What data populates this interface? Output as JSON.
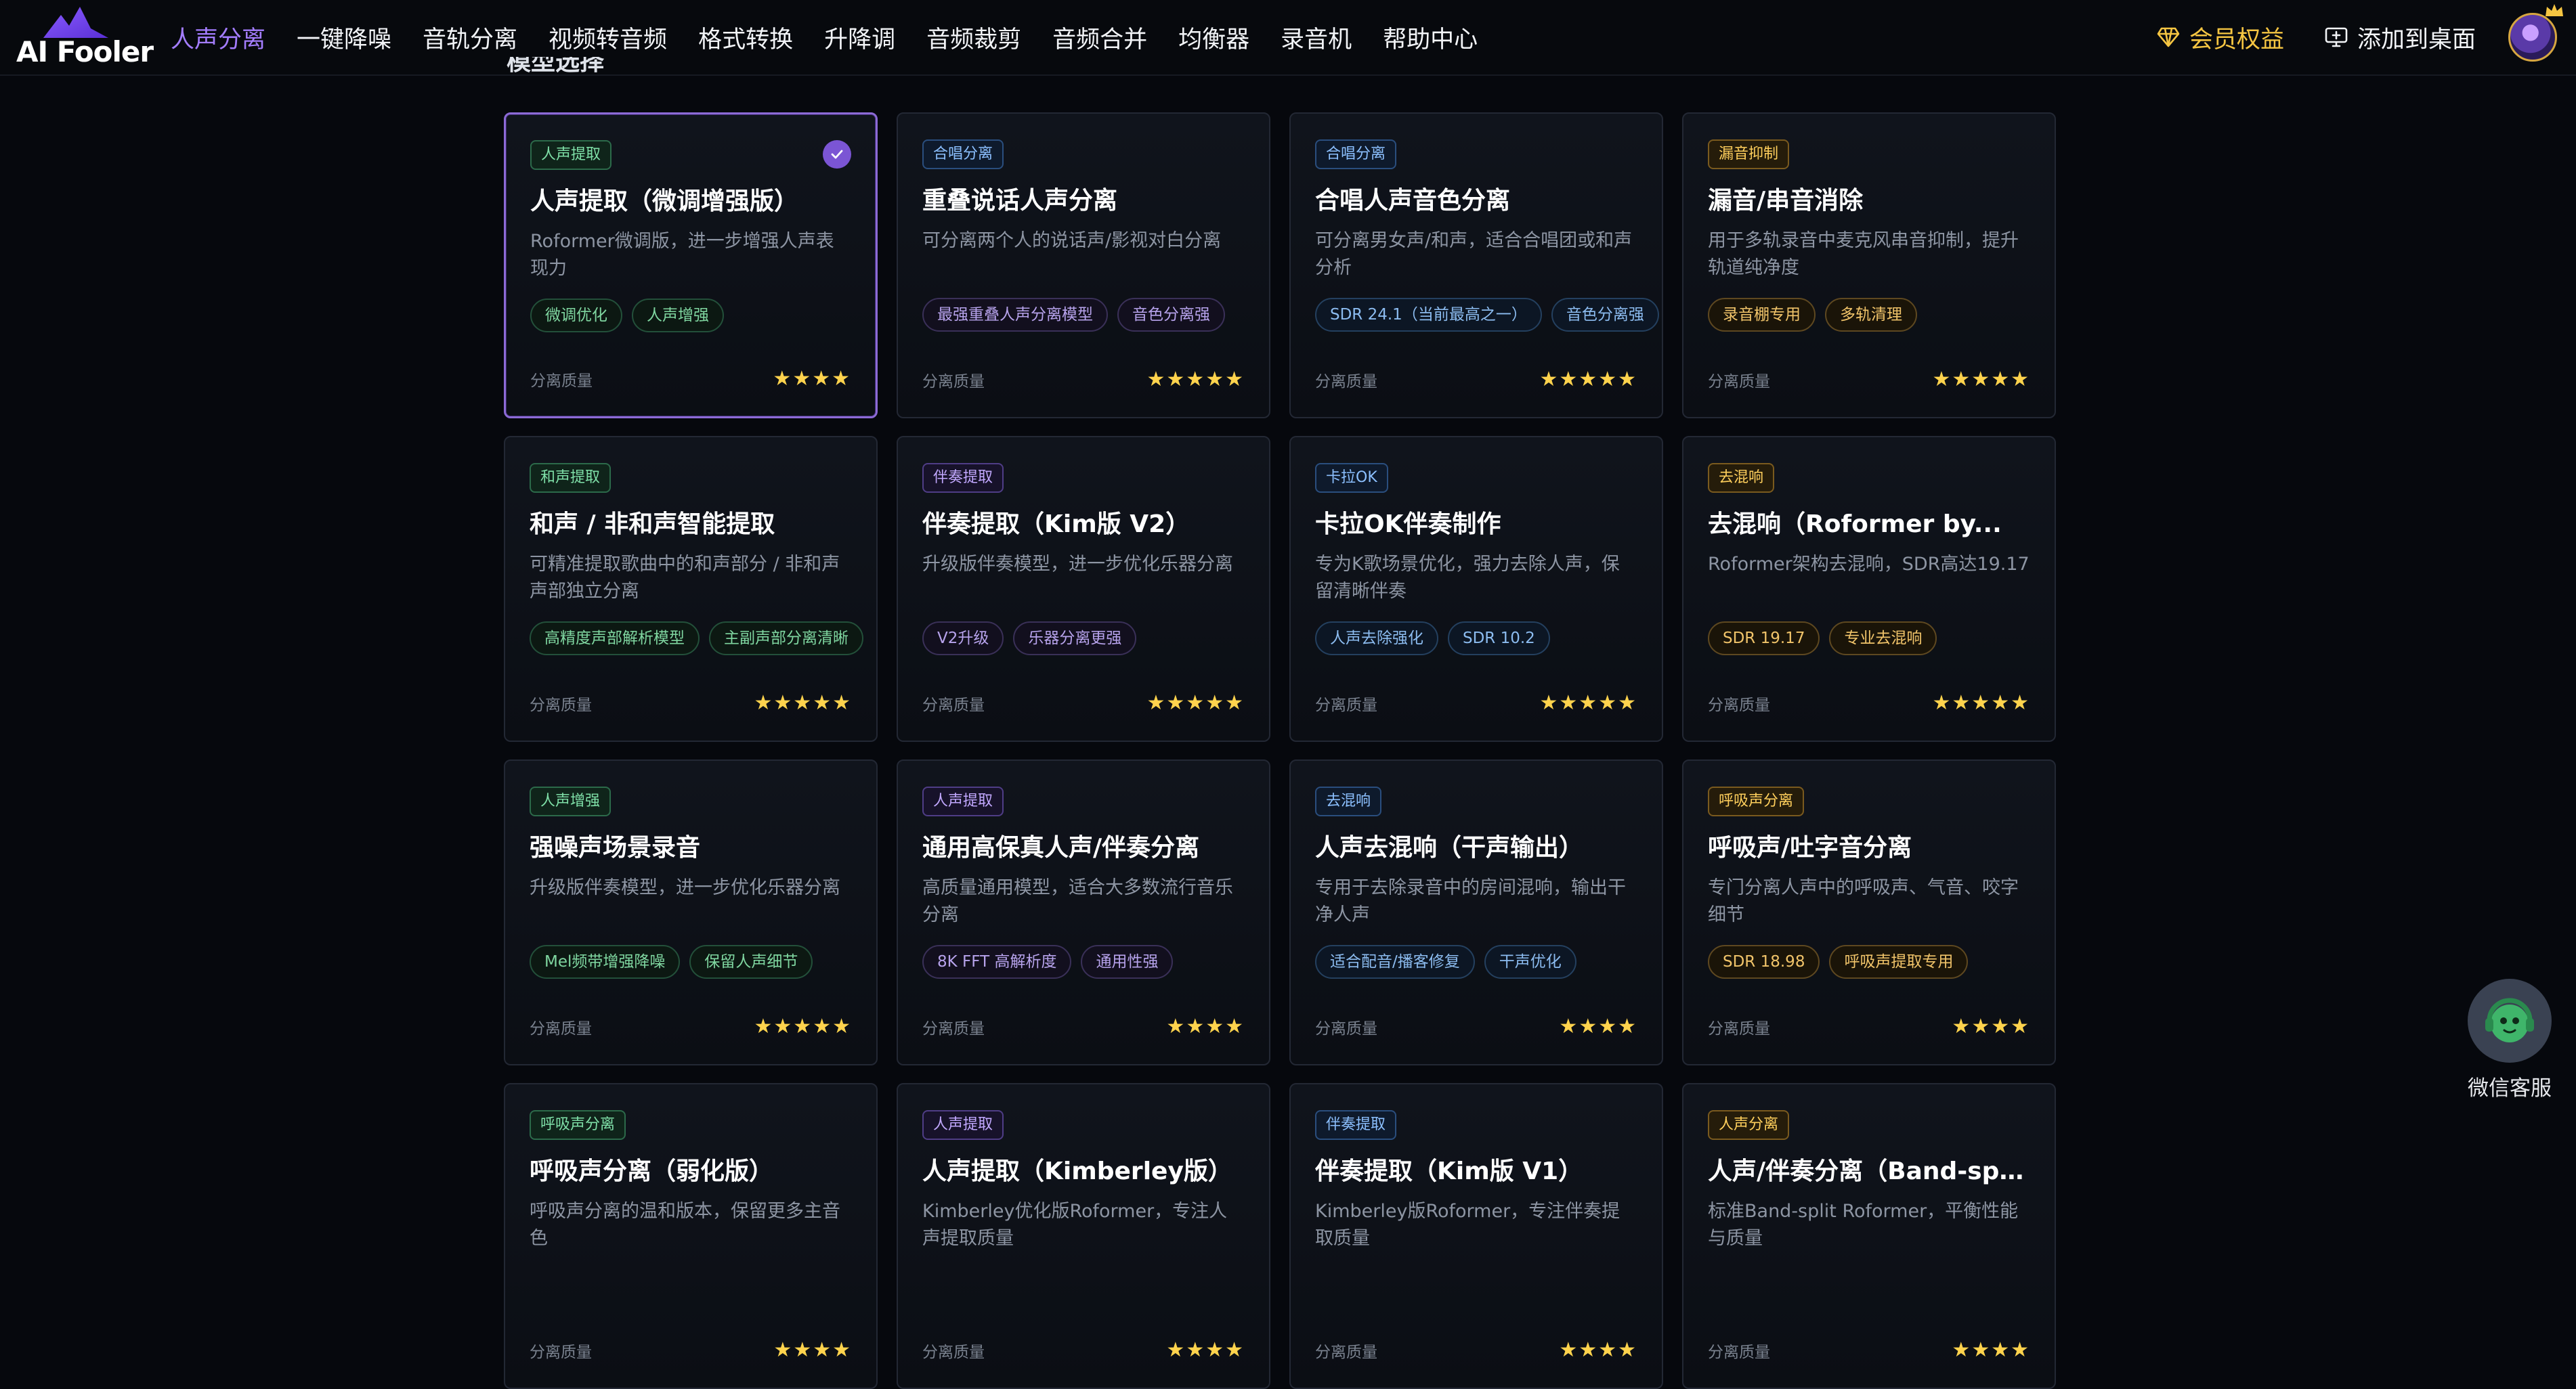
{
  "brand": {
    "name": "AI Fooler"
  },
  "nav": {
    "items": [
      {
        "label": "人声分离",
        "active": true
      },
      {
        "label": "一键降噪"
      },
      {
        "label": "音轨分离"
      },
      {
        "label": "视频转音频"
      },
      {
        "label": "格式转换"
      },
      {
        "label": "升降调"
      },
      {
        "label": "音频裁剪"
      },
      {
        "label": "音频合并"
      },
      {
        "label": "均衡器"
      },
      {
        "label": "录音机"
      },
      {
        "label": "帮助中心"
      }
    ],
    "vip_label": "会员权益",
    "desktop_label": "添加到桌面"
  },
  "section": {
    "title": "模型选择"
  },
  "cards": [
    {
      "category": "人声提取",
      "cat_color": "green",
      "title": "人声提取（微调增强版）",
      "desc": "Roformer微调版，进一步增强人声表现力",
      "tags": [
        "微调优化",
        "人声增强"
      ],
      "tag_color": "green",
      "quality_label": "分离质量",
      "rating": 4,
      "selected": true
    },
    {
      "category": "合唱分离",
      "cat_color": "blue",
      "title": "重叠说话人声分离",
      "desc": "可分离两个人的说话声/影视对白分离",
      "tags": [
        "最强重叠人声分离模型",
        "音色分离强"
      ],
      "tag_color": "purple",
      "quality_label": "分离质量",
      "rating": 5
    },
    {
      "category": "合唱分离",
      "cat_color": "blue",
      "title": "合唱人声音色分离",
      "desc": "可分离男女声/和声，适合合唱团或和声分析",
      "tags": [
        "SDR 24.1（当前最高之一）",
        "音色分离强"
      ],
      "tag_color": "blue",
      "quality_label": "分离质量",
      "rating": 5
    },
    {
      "category": "漏音抑制",
      "cat_color": "amber",
      "title": "漏音/串音消除",
      "desc": "用于多轨录音中麦克风串音抑制，提升轨道纯净度",
      "tags": [
        "录音棚专用",
        "多轨清理"
      ],
      "tag_color": "amber",
      "quality_label": "分离质量",
      "rating": 5
    },
    {
      "category": "和声提取",
      "cat_color": "green",
      "title": "和声 / 非和声智能提取",
      "desc": "可精准提取歌曲中的和声部分 / 非和声声部独立分离",
      "tags": [
        "高精度声部解析模型",
        "主副声部分离清晰"
      ],
      "tag_color": "green",
      "quality_label": "分离质量",
      "rating": 5
    },
    {
      "category": "伴奏提取",
      "cat_color": "purple",
      "title": "伴奏提取（Kim版 V2）",
      "desc": "升级版伴奏模型，进一步优化乐器分离",
      "tags": [
        "V2升级",
        "乐器分离更强"
      ],
      "tag_color": "purple",
      "quality_label": "分离质量",
      "rating": 5
    },
    {
      "category": "卡拉OK",
      "cat_color": "blue",
      "title": "卡拉OK伴奏制作",
      "desc": "专为K歌场景优化，强力去除人声，保留清晰伴奏",
      "tags": [
        "人声去除强化",
        "SDR 10.2"
      ],
      "tag_color": "blue",
      "quality_label": "分离质量",
      "rating": 5
    },
    {
      "category": "去混响",
      "cat_color": "amber",
      "title": "去混响（Roformer by...",
      "desc": "Roformer架构去混响，SDR高达19.17",
      "tags": [
        "SDR 19.17",
        "专业去混响"
      ],
      "tag_color": "amber",
      "quality_label": "分离质量",
      "rating": 5
    },
    {
      "category": "人声增强",
      "cat_color": "green",
      "title": "强噪声场景录音",
      "desc": "升级版伴奏模型，进一步优化乐器分离",
      "tags": [
        "Mel频带增强降噪",
        "保留人声细节"
      ],
      "tag_color": "green",
      "quality_label": "分离质量",
      "rating": 5
    },
    {
      "category": "人声提取",
      "cat_color": "purple",
      "title": "通用高保真人声/伴奏分离",
      "desc": "高质量通用模型，适合大多数流行音乐分离",
      "tags": [
        "8K FFT 高解析度",
        "通用性强"
      ],
      "tag_color": "purple",
      "quality_label": "分离质量",
      "rating": 4
    },
    {
      "category": "去混响",
      "cat_color": "blue",
      "title": "人声去混响（干声输出）",
      "desc": "专用于去除录音中的房间混响，输出干净人声",
      "tags": [
        "适合配音/播客修复",
        "干声优化"
      ],
      "tag_color": "blue",
      "quality_label": "分离质量",
      "rating": 4
    },
    {
      "category": "呼吸声分离",
      "cat_color": "amber",
      "title": "呼吸声/吐字音分离",
      "desc": "专门分离人声中的呼吸声、气音、咬字细节",
      "tags": [
        "SDR 18.98",
        "呼吸声提取专用"
      ],
      "tag_color": "amber",
      "quality_label": "分离质量",
      "rating": 4
    },
    {
      "category": "呼吸声分离",
      "cat_color": "green",
      "title": "呼吸声分离（弱化版）",
      "desc": "呼吸声分离的温和版本，保留更多主音色",
      "tags": [],
      "tag_color": "green",
      "quality_label": "分离质量",
      "rating": 4
    },
    {
      "category": "人声提取",
      "cat_color": "purple",
      "title": "人声提取（Kimberley版）",
      "desc": "Kimberley优化版Roformer，专注人声提取质量",
      "tags": [],
      "tag_color": "purple",
      "quality_label": "分离质量",
      "rating": 4
    },
    {
      "category": "伴奏提取",
      "cat_color": "blue",
      "title": "伴奏提取（Kim版 V1）",
      "desc": "Kimberley版Roformer，专注伴奏提取质量",
      "tags": [],
      "tag_color": "blue",
      "quality_label": "分离质量",
      "rating": 4
    },
    {
      "category": "人声分离",
      "cat_color": "amber",
      "title": "人声/伴奏分离（Band-split）",
      "desc": "标准Band-split Roformer，平衡性能与质量",
      "tags": [],
      "tag_color": "amber",
      "quality_label": "分离质量",
      "rating": 4
    }
  ],
  "service": {
    "label": "微信客服"
  },
  "colors": {
    "accent": "#a47dff",
    "vip": "#f5c542",
    "star": "#ffd34d",
    "background": "#06080d"
  }
}
